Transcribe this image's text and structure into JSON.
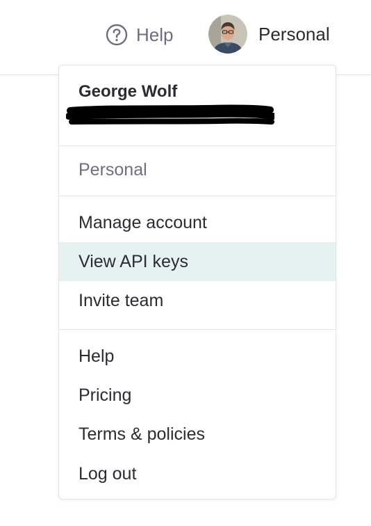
{
  "topbar": {
    "help_label": "Help",
    "account_label": "Personal"
  },
  "menu": {
    "user_name": "George Wolf",
    "org_label": "Personal",
    "account_items": [
      {
        "label": "Manage account"
      },
      {
        "label": "View API keys"
      },
      {
        "label": "Invite team"
      }
    ],
    "support_items": [
      {
        "label": "Help"
      },
      {
        "label": "Pricing"
      },
      {
        "label": "Terms & policies"
      },
      {
        "label": "Log out"
      }
    ]
  },
  "colors": {
    "hover_bg": "#e6f2f2",
    "muted_text": "#6e6e80",
    "primary_text": "#2b2b33",
    "divider": "#e3e3e8"
  },
  "icons": {
    "help": "question-circle-icon",
    "avatar": "user-photo-avatar",
    "redaction": "black-marker-redaction"
  }
}
